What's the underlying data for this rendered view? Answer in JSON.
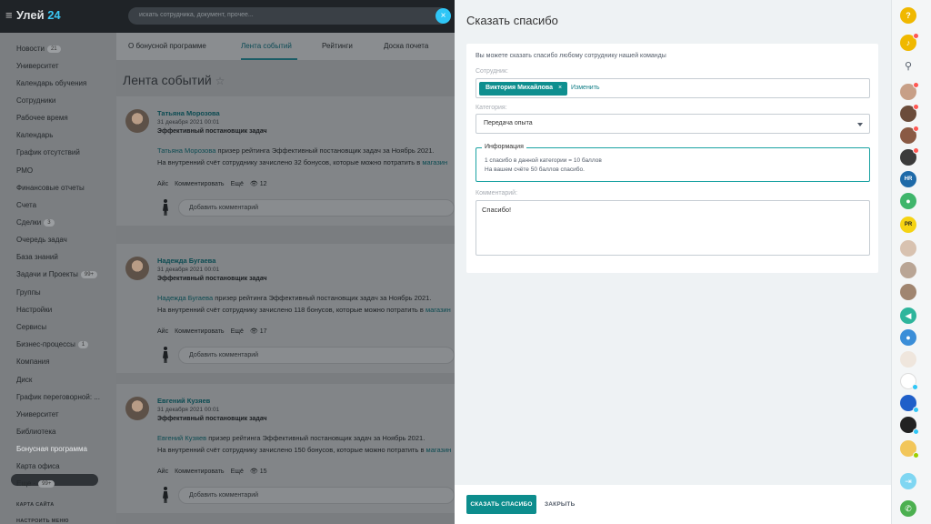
{
  "topbar": {
    "logo_text": "Улей",
    "logo_num": "24",
    "search_placeholder": "искать сотрудника, документ, прочее..."
  },
  "sidebar": {
    "items": [
      {
        "label": "Новости",
        "badge": "21"
      },
      {
        "label": "Университет",
        "badge": ""
      },
      {
        "label": "Календарь обучения",
        "badge": ""
      },
      {
        "label": "Сотрудники",
        "badge": ""
      },
      {
        "label": "Рабочее время",
        "badge": ""
      },
      {
        "label": "Календарь",
        "badge": ""
      },
      {
        "label": "График отсутствий",
        "badge": ""
      },
      {
        "label": "РМО",
        "badge": ""
      },
      {
        "label": "Финансовые отчеты",
        "badge": ""
      },
      {
        "label": "Счета",
        "badge": ""
      },
      {
        "label": "Сделки",
        "badge": "3"
      },
      {
        "label": "Очередь задач",
        "badge": ""
      },
      {
        "label": "База знаний",
        "badge": ""
      },
      {
        "label": "Задачи и Проекты",
        "badge": "99+"
      },
      {
        "label": "Группы",
        "badge": ""
      },
      {
        "label": "Настройки",
        "badge": ""
      },
      {
        "label": "Сервисы",
        "badge": ""
      },
      {
        "label": "Бизнес-процессы",
        "badge": "1"
      },
      {
        "label": "Компания",
        "badge": ""
      },
      {
        "label": "Диск",
        "badge": ""
      },
      {
        "label": "График переговорной: ...",
        "badge": ""
      },
      {
        "label": "Университет",
        "badge": ""
      },
      {
        "label": "Библиотека",
        "badge": ""
      },
      {
        "label": "Бонусная программа",
        "badge": ""
      },
      {
        "label": "Карта офиса",
        "badge": ""
      },
      {
        "label": "Еще ·",
        "badge": "99+"
      }
    ],
    "footer": [
      "КАРТА САЙТА",
      "НАСТРОИТЬ МЕНЮ"
    ]
  },
  "tabs": [
    "О бонусной программе",
    "Лента событий",
    "Рейтинги",
    "Доска почета"
  ],
  "page": {
    "title": "Лента событий",
    "star": "☆"
  },
  "posts": [
    {
      "author": "Татьяна Морозова",
      "date": "31 декабря 2021 00:01",
      "title": "Эффективный постановщик задач",
      "line1_name": "Татьяна Морозова",
      "line1_rest": " призер рейтинга Эффективный постановщик задач за Ноябрь 2021.",
      "line2": "На внутренний счёт сотруднику зачислено 32 бонусов, которые можно потратить в ",
      "line2_link": "магазин",
      "a1": "Айс",
      "a2": "Комментировать",
      "a3": "Ещё",
      "views": "👁 12",
      "comment": "Добавить комментарий"
    },
    {
      "author": "Надежда Бугаева",
      "date": "31 декабря 2021 00:01",
      "title": "Эффективный постановщик задач",
      "line1_name": "Надежда Бугаева",
      "line1_rest": " призер рейтинга Эффективный постановщик задач за Ноябрь 2021.",
      "line2": "На внутренний счёт сотруднику зачислено 118 бонусов, которые можно потратить в ",
      "line2_link": "магазин",
      "a1": "Айс",
      "a2": "Комментировать",
      "a3": "Ещё",
      "views": "👁 17",
      "comment": "Добавить комментарий"
    },
    {
      "author": "Евгений Кузяев",
      "date": "31 декабря 2021 00:01",
      "title": "Эффективный постановщик задач",
      "line1_name": "Евгений Кузяев",
      "line1_rest": " призер рейтинга Эффективный постановщик задач за Ноябрь 2021.",
      "line2": "На внутренний счёт сотруднику зачислено 150 бонусов, которые можно потратить в ",
      "line2_link": "магазин",
      "a1": "Айс",
      "a2": "Комментировать",
      "a3": "Ещё",
      "views": "👁 15",
      "comment": "Добавить комментарий"
    }
  ],
  "panel": {
    "title": "Сказать спасибо",
    "hint": "Вы можете сказать спасибо любому сотруднику нашей команды",
    "employee_label": "Сотрудник:",
    "employee_tag": "Виктория Михайлова",
    "employee_remove": "×",
    "employee_change": "Изменить",
    "category_label": "Категория:",
    "category_value": "Передача опыта",
    "info_legend": "Информация",
    "info_line1": "1 спасибо в данной категории = 10 баллов",
    "info_line2": "На вашем счёте 50 баллов спасибо.",
    "comment_label": "Комментарий:",
    "comment_value": "Спасибо!",
    "submit": "СКАЗАТЬ СПАСИБО",
    "close": "ЗАКРЫТЬ"
  },
  "rail": {
    "help_icon": "?",
    "search_icon": "⚲",
    "hr_label": "HR",
    "pr_label": "PR"
  },
  "colors": {
    "accent": "#0d8d8d",
    "link": "#0f7d86",
    "badge": "#ff5752"
  }
}
